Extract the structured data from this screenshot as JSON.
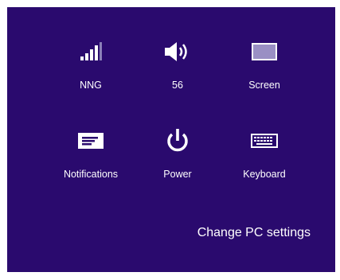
{
  "settings": {
    "tiles": [
      {
        "label": "NNG",
        "icon": "signal-bars-icon"
      },
      {
        "label": "56",
        "icon": "volume-icon"
      },
      {
        "label": "Screen",
        "icon": "screen-icon"
      },
      {
        "label": "Notifications",
        "icon": "notifications-icon"
      },
      {
        "label": "Power",
        "icon": "power-icon"
      },
      {
        "label": "Keyboard",
        "icon": "keyboard-icon"
      }
    ],
    "change_pc_settings": "Change PC settings"
  },
  "colors": {
    "background": "#2a0a6e",
    "foreground": "#ffffff",
    "screen_fill": "#9a8fc4"
  }
}
